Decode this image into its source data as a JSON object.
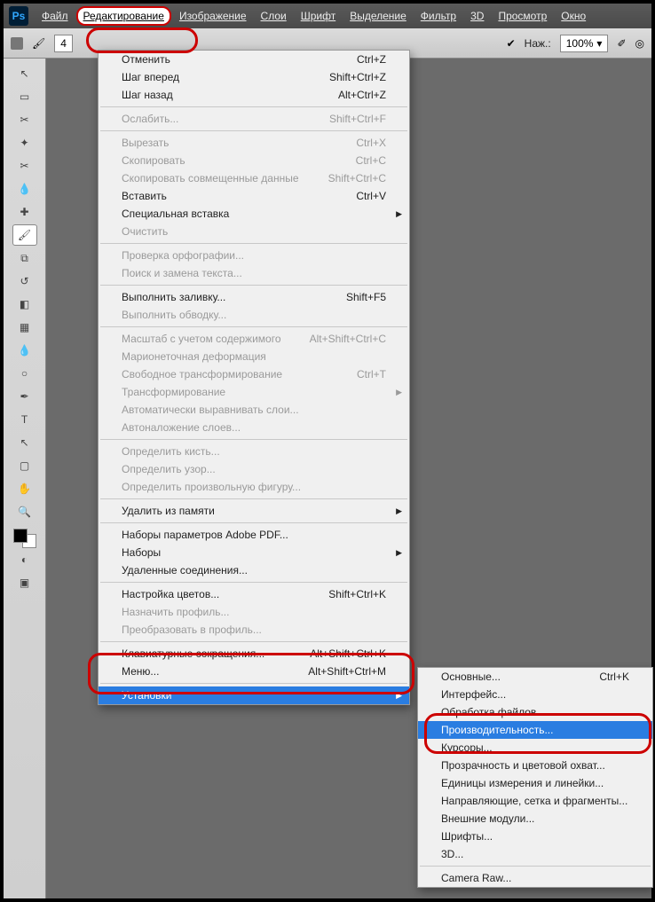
{
  "app": {
    "logo": "Ps"
  },
  "menubar": {
    "items": [
      "Файл",
      "Редактирование",
      "Изображение",
      "Слои",
      "Шрифт",
      "Выделение",
      "Фильтр",
      "3D",
      "Просмотр",
      "Окно"
    ],
    "open_index": 1
  },
  "options_bar": {
    "press_label": "Наж.:",
    "press_value": "100%"
  },
  "edit_menu": {
    "groups": [
      [
        {
          "label": "Отменить",
          "shortcut": "Ctrl+Z"
        },
        {
          "label": "Шаг вперед",
          "shortcut": "Shift+Ctrl+Z"
        },
        {
          "label": "Шаг назад",
          "shortcut": "Alt+Ctrl+Z"
        }
      ],
      [
        {
          "label": "Ослабить...",
          "shortcut": "Shift+Ctrl+F",
          "disabled": true
        }
      ],
      [
        {
          "label": "Вырезать",
          "shortcut": "Ctrl+X",
          "disabled": true
        },
        {
          "label": "Скопировать",
          "shortcut": "Ctrl+C",
          "disabled": true
        },
        {
          "label": "Скопировать совмещенные данные",
          "shortcut": "Shift+Ctrl+C",
          "disabled": true
        },
        {
          "label": "Вставить",
          "shortcut": "Ctrl+V"
        },
        {
          "label": "Специальная вставка",
          "submenu": true
        },
        {
          "label": "Очистить",
          "disabled": true
        }
      ],
      [
        {
          "label": "Проверка орфографии...",
          "disabled": true
        },
        {
          "label": "Поиск и замена текста...",
          "disabled": true
        }
      ],
      [
        {
          "label": "Выполнить заливку...",
          "shortcut": "Shift+F5"
        },
        {
          "label": "Выполнить обводку...",
          "disabled": true
        }
      ],
      [
        {
          "label": "Масштаб с учетом содержимого",
          "shortcut": "Alt+Shift+Ctrl+C",
          "disabled": true
        },
        {
          "label": "Марионеточная деформация",
          "disabled": true
        },
        {
          "label": "Свободное трансформирование",
          "shortcut": "Ctrl+T",
          "disabled": true
        },
        {
          "label": "Трансформирование",
          "submenu": true,
          "disabled": true
        },
        {
          "label": "Автоматически выравнивать слои...",
          "disabled": true
        },
        {
          "label": "Автоналожение слоев...",
          "disabled": true
        }
      ],
      [
        {
          "label": "Определить кисть...",
          "disabled": true
        },
        {
          "label": "Определить узор...",
          "disabled": true
        },
        {
          "label": "Определить произвольную фигуру...",
          "disabled": true
        }
      ],
      [
        {
          "label": "Удалить из памяти",
          "submenu": true
        }
      ],
      [
        {
          "label": "Наборы параметров Adobe PDF..."
        },
        {
          "label": "Наборы",
          "submenu": true
        },
        {
          "label": "Удаленные соединения..."
        }
      ],
      [
        {
          "label": "Настройка цветов...",
          "shortcut": "Shift+Ctrl+K"
        },
        {
          "label": "Назначить профиль...",
          "disabled": true
        },
        {
          "label": "Преобразовать в профиль...",
          "disabled": true
        }
      ],
      [
        {
          "label": "Клавиатурные сокращения...",
          "shortcut": "Alt+Shift+Ctrl+K"
        },
        {
          "label": "Меню...",
          "shortcut": "Alt+Shift+Ctrl+M"
        }
      ],
      [
        {
          "label": "Установки",
          "submenu": true,
          "highlight": true
        }
      ]
    ]
  },
  "submenu": {
    "groups": [
      [
        {
          "label": "Основные...",
          "shortcut": "Ctrl+K"
        },
        {
          "label": "Интерфейс..."
        },
        {
          "label": "Обработка файлов..."
        },
        {
          "label": "Производительность...",
          "highlight": true
        },
        {
          "label": "Курсоры..."
        },
        {
          "label": "Прозрачность и цветовой охват..."
        },
        {
          "label": "Единицы измерения и линейки..."
        },
        {
          "label": "Направляющие, сетка и фрагменты..."
        },
        {
          "label": "Внешние модули..."
        },
        {
          "label": "Шрифты..."
        },
        {
          "label": "3D..."
        }
      ],
      [
        {
          "label": "Camera Raw..."
        }
      ]
    ]
  },
  "tools": [
    "move",
    "marquee",
    "lasso",
    "wand",
    "crop",
    "eyedropper",
    "healing",
    "brush",
    "stamp",
    "history-brush",
    "eraser",
    "gradient",
    "blur",
    "dodge",
    "pen",
    "type",
    "path-select",
    "shape",
    "hand",
    "zoom"
  ]
}
